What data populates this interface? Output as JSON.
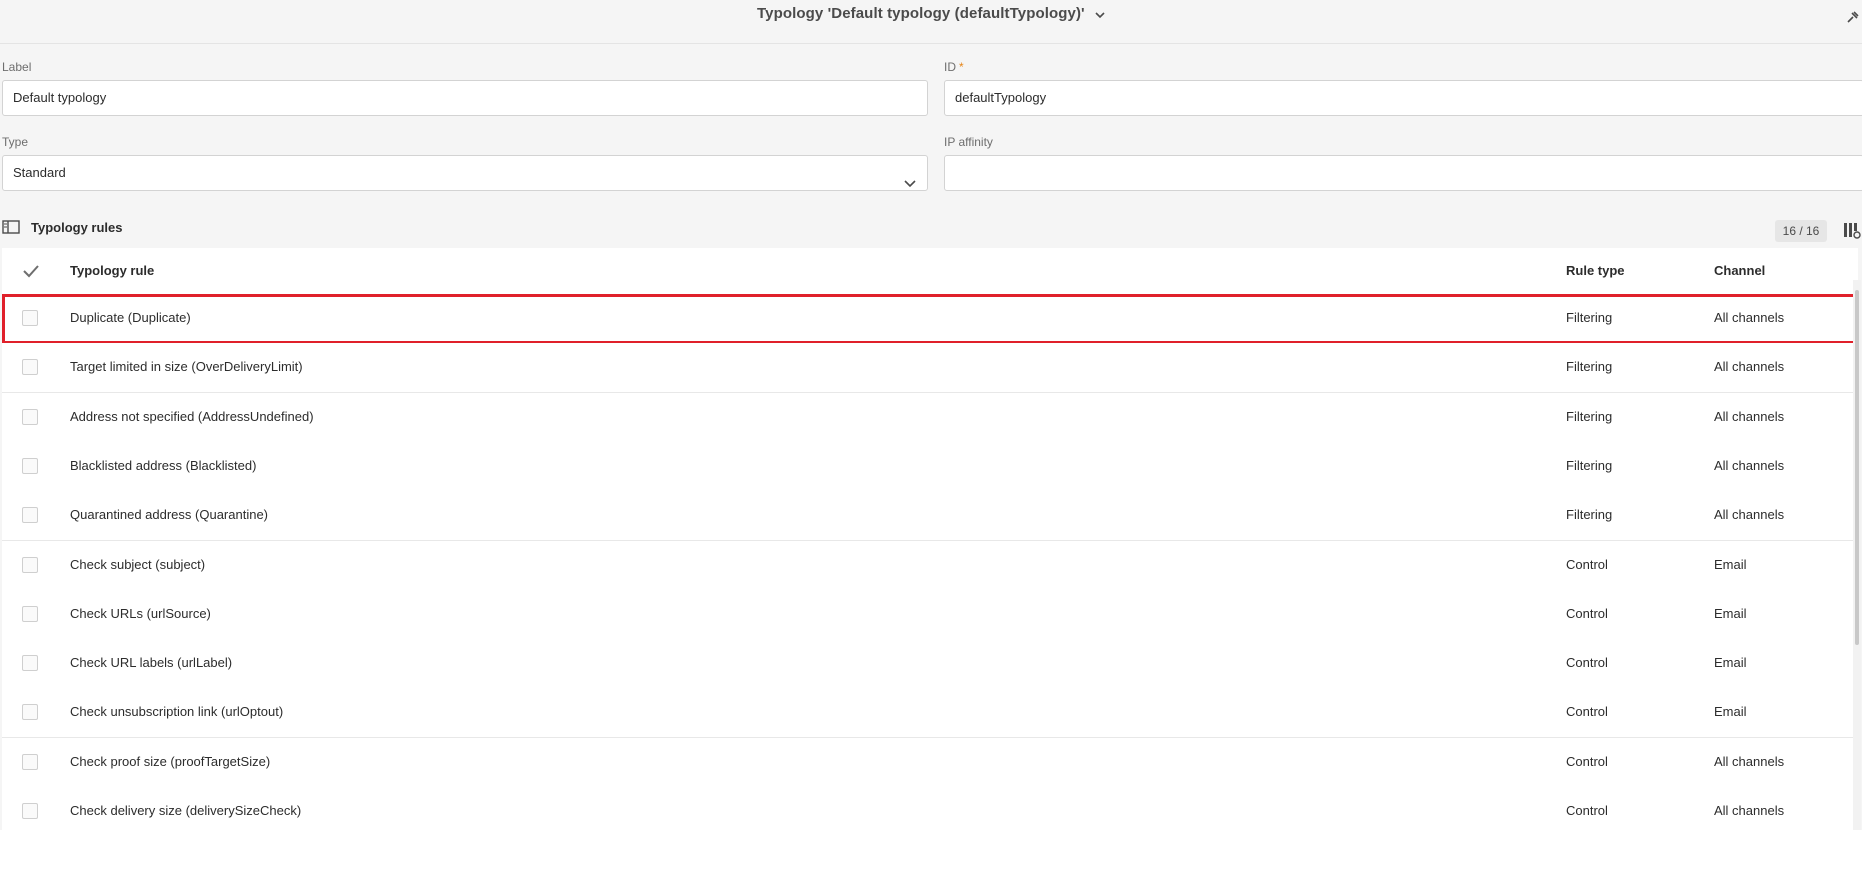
{
  "header": {
    "title": "Typology 'Default typology (defaultTypology)'"
  },
  "form": {
    "label": {
      "caption": "Label",
      "value": "Default typology"
    },
    "id": {
      "caption": "ID",
      "required_mark": "*",
      "value": "defaultTypology"
    },
    "type": {
      "caption": "Type",
      "value": "Standard"
    },
    "ip_affinity": {
      "caption": "IP affinity",
      "value": ""
    }
  },
  "section": {
    "title": "Typology rules",
    "count": "16 / 16"
  },
  "table": {
    "columns": [
      "Typology rule",
      "Rule type",
      "Channel"
    ],
    "rows": [
      {
        "rule": "Duplicate (Duplicate)",
        "type": "Filtering",
        "channel": "All channels",
        "highlighted": true
      },
      {
        "rule": "Target limited in size (OverDeliveryLimit)",
        "type": "Filtering",
        "channel": "All channels"
      },
      {
        "rule": "Address not specified (AddressUndefined)",
        "type": "Filtering",
        "channel": "All channels"
      },
      {
        "rule": "Blacklisted address (Blacklisted)",
        "type": "Filtering",
        "channel": "All channels"
      },
      {
        "rule": "Quarantined address (Quarantine)",
        "type": "Filtering",
        "channel": "All channels"
      },
      {
        "rule": "Check subject (subject)",
        "type": "Control",
        "channel": "Email"
      },
      {
        "rule": "Check URLs (urlSource)",
        "type": "Control",
        "channel": "Email"
      },
      {
        "rule": "Check URL labels (urlLabel)",
        "type": "Control",
        "channel": "Email"
      },
      {
        "rule": "Check unsubscription link (urlOptout)",
        "type": "Control",
        "channel": "Email"
      },
      {
        "rule": "Check proof size (proofTargetSize)",
        "type": "Control",
        "channel": "All channels"
      },
      {
        "rule": "Check delivery size (deliverySizeCheck)",
        "type": "Control",
        "channel": "All channels"
      }
    ]
  },
  "colors": {
    "highlight": "#e0202a",
    "required": "#e68619",
    "background": "#f5f5f5"
  },
  "icons": [
    "chevron-down-icon",
    "pin-icon",
    "panel-icon",
    "columns-icon",
    "checkmark-icon"
  ]
}
